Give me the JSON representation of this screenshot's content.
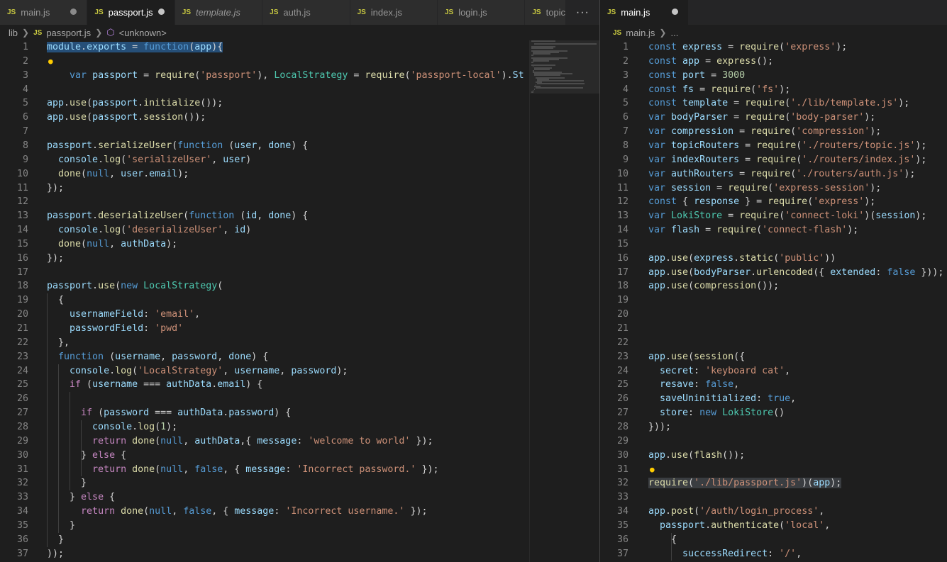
{
  "left": {
    "tabs": [
      {
        "label": "main.js",
        "active": false,
        "dirty": true,
        "italic": false
      },
      {
        "label": "passport.js",
        "active": true,
        "dirty": true,
        "italic": false
      },
      {
        "label": "template.js",
        "active": false,
        "dirty": false,
        "italic": true
      },
      {
        "label": "auth.js",
        "active": false,
        "dirty": false,
        "italic": false
      },
      {
        "label": "index.js",
        "active": false,
        "dirty": false,
        "italic": false
      },
      {
        "label": "login.js",
        "active": false,
        "dirty": false,
        "italic": false
      },
      {
        "label": "topic.js",
        "active": false,
        "dirty": false,
        "italic": false
      }
    ],
    "more_label": "···",
    "breadcrumb": {
      "folder": "lib",
      "file": "passport.js",
      "symbol": "<unknown>",
      "js_badge": "JS"
    },
    "lines": [
      "module.exports = function(app){",
      "",
      "    var passport = require('passport'), LocalStrategy = require('passport-local').St",
      "",
      "app.use(passport.initialize());",
      "app.use(passport.session());",
      "",
      "passport.serializeUser(function (user, done) {",
      "  console.log('serializeUser', user)",
      "  done(null, user.email);",
      "});",
      "",
      "passport.deserializeUser(function (id, done) {",
      "  console.log('deserializeUser', id)",
      "  done(null, authData);",
      "});",
      "",
      "passport.use(new LocalStrategy(",
      "  {",
      "    usernameField: 'email',",
      "    passwordField: 'pwd'",
      "  },",
      "  function (username, password, done) {",
      "    console.log('LocalStrategy', username, password);",
      "    if (username === authData.email) {",
      "",
      "      if (password === authData.password) {",
      "        console.log(1);",
      "        return done(null, authData,{ message: 'welcome to world' });",
      "      } else {",
      "        return done(null, false, { message: 'Incorrect password.' });",
      "      }",
      "    } else {",
      "      return done(null, false, { message: 'Incorrect username.' });",
      "    }",
      "  }",
      "));"
    ]
  },
  "right": {
    "tabs": [
      {
        "label": "main.js",
        "active": true,
        "dirty": true,
        "italic": false
      }
    ],
    "breadcrumb": {
      "file": "main.js",
      "tail": "...",
      "js_badge": "JS"
    },
    "lines": [
      "const express = require('express');",
      "const app = express();",
      "const port = 3000",
      "const fs = require('fs');",
      "const template = require('./lib/template.js');",
      "var bodyParser = require('body-parser');",
      "var compression = require('compression');",
      "var topicRouters = require('./routers/topic.js');",
      "var indexRouters = require('./routers/index.js');",
      "var authRouters = require('./routers/auth.js');",
      "var session = require('express-session');",
      "const { response } = require('express');",
      "var LokiStore = require('connect-loki')(session);",
      "var flash = require('connect-flash');",
      "",
      "app.use(express.static('public'))",
      "app.use(bodyParser.urlencoded({ extended: false }));",
      "app.use(compression());",
      "",
      "",
      "",
      "",
      "app.use(session({",
      "  secret: 'keyboard cat',",
      "  resave: false,",
      "  saveUninitialized: true,",
      "  store: new LokiStore()",
      "}));",
      "",
      "app.use(flash());",
      "",
      "require('./lib/passport.js')(app);",
      "",
      "app.post('/auth/login_process',",
      "  passport.authenticate('local',",
      "    {",
      "      successRedirect: '/',"
    ]
  },
  "colors": {
    "keyword": "#569cd6",
    "function": "#dcdcaa",
    "variable": "#9cdcfe",
    "string": "#ce9178",
    "number": "#b5cea8",
    "type": "#4ec9b0",
    "selection": "#264f78",
    "lightbulb": "#ffcc00",
    "js_badge": "#cbcb41"
  },
  "icons": {
    "lightbulb": "lightbulb-icon",
    "symbol": "cube-icon",
    "dirty_dot": "dot-icon",
    "more": "more-actions-icon"
  }
}
